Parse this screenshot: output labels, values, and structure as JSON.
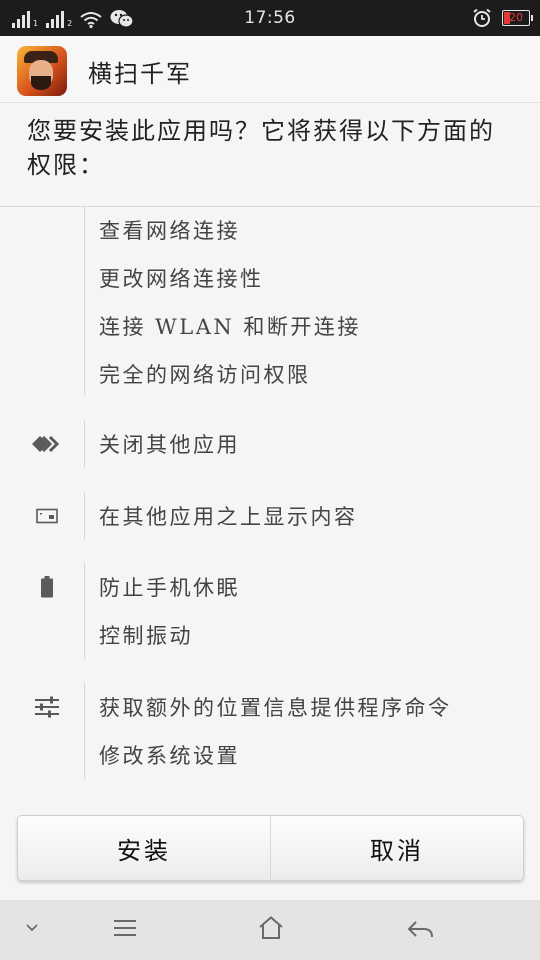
{
  "status_bar": {
    "time": "17:56",
    "battery_level": "20",
    "icons": [
      "signal-icon",
      "signal-icon",
      "wifi-icon",
      "wechat-icon",
      "alarm-icon",
      "battery-icon"
    ]
  },
  "app": {
    "name": "横扫千军",
    "icon": "app-icon"
  },
  "prompt": "您要安装此应用吗？它将获得以下方面的权限：",
  "permission_groups": [
    {
      "icon": "network-icon",
      "items": [
        "查看网络连接",
        "更改网络连接性",
        "连接 WLAN 和断开连接",
        "完全的网络访问权限"
      ]
    },
    {
      "icon": "apps-icon",
      "items": [
        "关闭其他应用"
      ]
    },
    {
      "icon": "window-icon",
      "items": [
        "在其他应用之上显示内容"
      ]
    },
    {
      "icon": "battery-icon",
      "items": [
        "防止手机休眠",
        "控制振动"
      ]
    },
    {
      "icon": "settings-sliders-icon",
      "items": [
        "获取额外的位置信息提供程序命令",
        "修改系统设置"
      ]
    }
  ],
  "buttons": {
    "install": "安装",
    "cancel": "取消"
  },
  "nav_bar": {
    "icons": [
      "chevron-down-icon",
      "menu-icon",
      "home-icon",
      "back-icon"
    ]
  }
}
